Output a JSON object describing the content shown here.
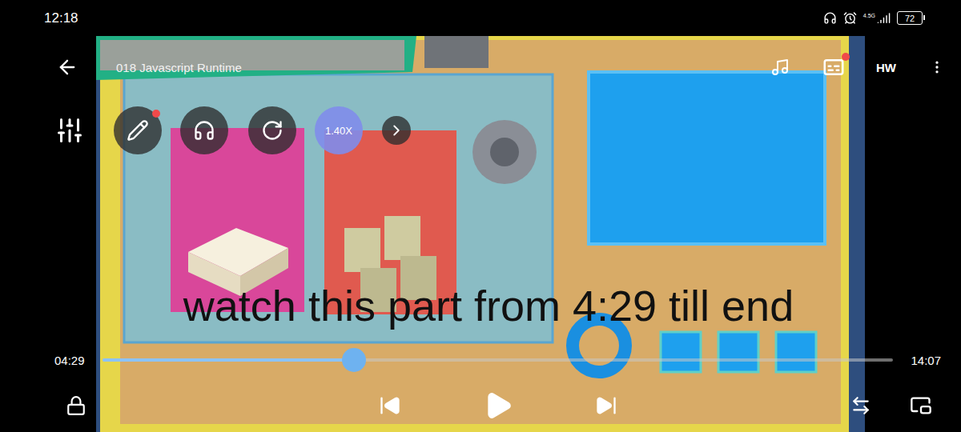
{
  "status_bar": {
    "time": "12:18",
    "network": "4.5G",
    "battery": "72"
  },
  "player": {
    "title": "018 Javascript Runtime",
    "quality": "HW",
    "subtitles": {
      "notified": true
    },
    "tools": [
      {
        "kind": "icon",
        "notified": true
      },
      {
        "kind": "icon",
        "notified": false
      },
      {
        "kind": "icon",
        "notified": false
      },
      {
        "kind": "speed",
        "label": "1.40X",
        "notified": false
      },
      {
        "kind": "arrow",
        "notified": false
      }
    ],
    "annotation": "watch this part from 4:29 till end",
    "seek": {
      "current": "04:29",
      "duration": "14:07",
      "level": 0.318
    }
  }
}
